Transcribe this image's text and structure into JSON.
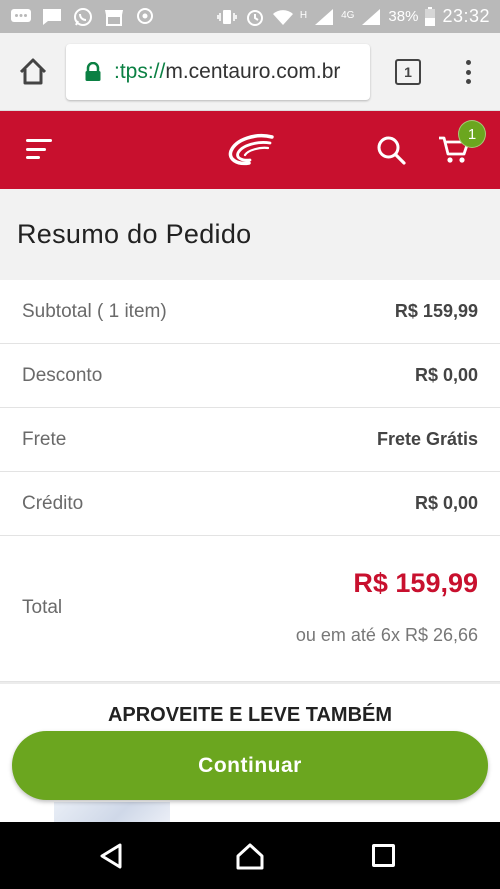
{
  "status_bar": {
    "network_h": "H",
    "network_4g": "4G",
    "battery": "38%",
    "time": "23:32"
  },
  "browser": {
    "url_scheme": ":tps://",
    "url_rest": "m.centauro.com.br",
    "tab_count": "1"
  },
  "header": {
    "cart_count": "1",
    "brand_color": "#c8102e"
  },
  "summary": {
    "title": "Resumo do Pedido",
    "rows": [
      {
        "label": "Subtotal ( 1 item)",
        "value": "R$ 159,99"
      },
      {
        "label": "Desconto",
        "value": "R$ 0,00"
      },
      {
        "label": "Frete",
        "value": "Frete Grátis"
      },
      {
        "label": "Crédito",
        "value": "R$ 0,00"
      }
    ],
    "total_label": "Total",
    "total_value": "R$ 159,99",
    "installment": "ou em até  6x R$ 26,66"
  },
  "recommendations": {
    "title": "APROVEITE E LEVE TAMBÉM",
    "rating": "★★★★★"
  },
  "actions": {
    "continue_label": "Continuar",
    "accent_color": "#6ba61f"
  }
}
